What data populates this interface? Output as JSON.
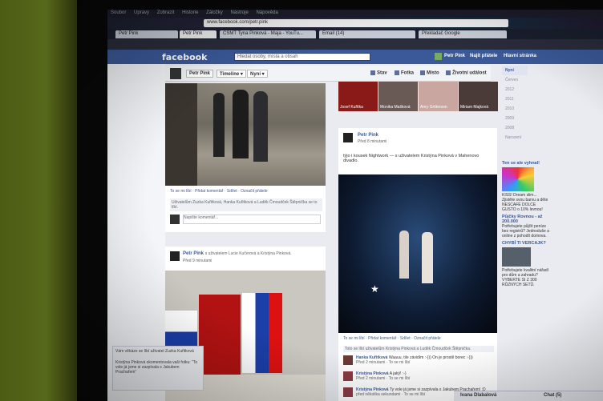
{
  "browser": {
    "menu": [
      "Soubor",
      "Úpravy",
      "Zobrazit",
      "Historie",
      "Záložky",
      "Nástroje",
      "Nápověda"
    ],
    "url": "www.facebook.com/petr.pink",
    "tabs": [
      {
        "label": "Petr Pink"
      },
      {
        "label": "Petr Pink"
      },
      {
        "label": "ČSMT Tyna Pinková - Maja - YouTu..."
      },
      {
        "label": "Email (14)"
      },
      {
        "label": "Překladač Google"
      }
    ]
  },
  "fb": {
    "logo": "facebook",
    "search_placeholder": "Hledat osoby, místa a obsah",
    "user": "Petr Pink",
    "find_friends": "Najít přátele",
    "home": "Hlavní stránka"
  },
  "timeline": {
    "name_btn": "Petr Pink",
    "timeline_btn": "Timeline ▾",
    "now_btn": "Nyní ▾",
    "actions": [
      "Stav",
      "Fotka",
      "Místo",
      "Životní událost"
    ]
  },
  "post1": {
    "actions": "To se mi líbí · Přidat komentář · Sdílet · Označit přátele",
    "likes": "Uživatelům Zuzka Kuřitková, Hanka Kuřitková a Luděk Čmoudček Štěpnička se to líbí.",
    "comment_placeholder": "Napište komentář..."
  },
  "post2": {
    "author": "Petr Pink",
    "with": "s uživatelem Lucie Kučerová a Kristýna Pinková.",
    "time": "Před 9 minutami"
  },
  "friends_row": [
    {
      "name": "Josef Kuřitka",
      "color": "#8a1a18"
    },
    {
      "name": "Monika Mašková",
      "color": "#6a5a55"
    },
    {
      "name": "Anry Gritterson",
      "color": "#c9a7a0"
    },
    {
      "name": "Miriam Majková",
      "color": "#4a3a38"
    }
  ],
  "post3": {
    "author": "Petr Pink",
    "time": "Před 8 minutami",
    "text": "týjo i kousek Nightwork — s uživatelem Kristýna Pinková v Mahenovo divadlo.",
    "actions": "To se mi líbí · Přidat komentář · Sdílet · Označit přátele",
    "likes": "Toto se líbí uživatelům Kristýna Pinková a Luděk Čmoudček Štěpnička.",
    "comments": [
      {
        "name": "Hanka Kuřitková",
        "text": "Waauu, tile závidím :-))) On je prostě borec :-)))",
        "time": "Před 2 minutami · To se mi líbí"
      },
      {
        "name": "Kristýna Pinková",
        "text": "A jaký! :-)",
        "time": "Před 2 minutami · To se mi líbí"
      },
      {
        "name": "Kristýna Pinková",
        "text": "Ty vole já jsme si zazpívala s Jakubem Prachařem! :D",
        "time": "před několika sekundami · To se mi líbí"
      }
    ]
  },
  "years": [
    "Nyní",
    "Červen",
    "2012",
    "2011",
    "2010",
    "2009",
    "2008",
    "Narození"
  ],
  "ads": [
    {
      "title": "Ten se ale vyhnal!",
      "text": "KISS! Dream slim... Zjistěte svou barvu a děte NESCAFÉ DOLCE GUSTO o 10% levnou!"
    },
    {
      "title": "Půjčky Rovnou - až 200.000",
      "text": "Potřebujete půjčit peníze bez registrů? Jednoduše a online z pohodlí domova."
    },
    {
      "title": "CHYBÍ TI VERCAJK?",
      "text": "Potřebujete kvalitní nářadí pro dům a zahradu? VYBERTE SI Z 300 RŮZNÝCH SETŮ."
    }
  ],
  "notification": {
    "line1": "Vám věkáze se líbí uživatel Zuzka Kuřitková",
    "line2": "Kristýna Pinková okomentovala vaši fotku: \"To vole já jsme si zazpívala s Jakubem Prachařem\""
  },
  "chat": {
    "user": "Ivana Dlabalová",
    "label": "Chat (5)"
  },
  "colors": {
    "facebook_blue": "#3b5998"
  }
}
